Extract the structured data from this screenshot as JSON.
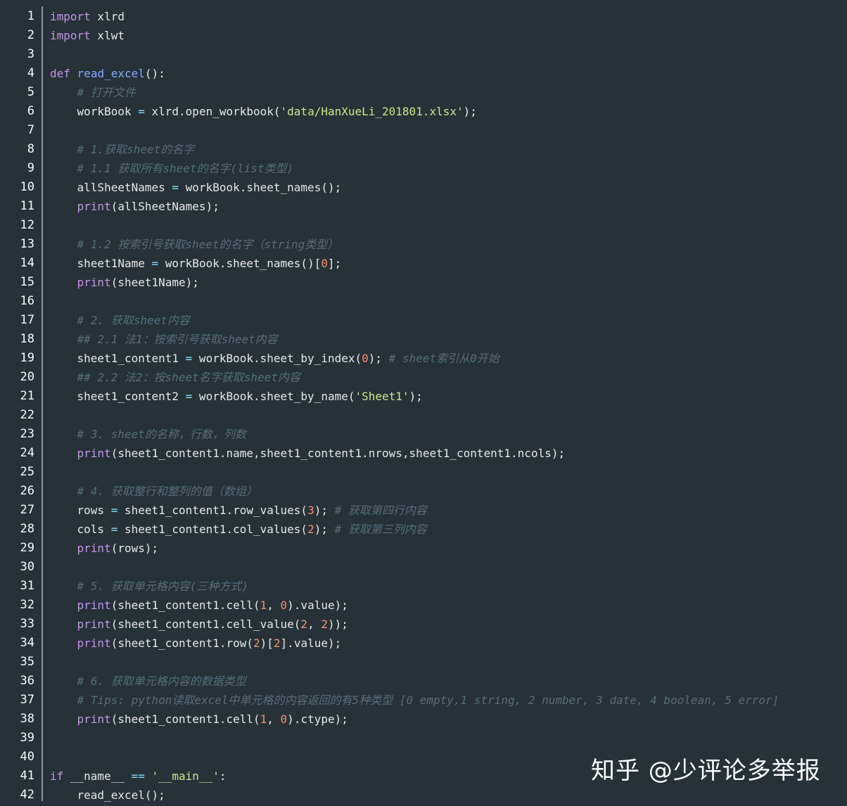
{
  "editor": {
    "lines": [
      {
        "n": "1",
        "t": [
          [
            "kw",
            "import"
          ],
          [
            "pl",
            " xlrd"
          ]
        ]
      },
      {
        "n": "2",
        "t": [
          [
            "kw",
            "import"
          ],
          [
            "pl",
            " xlwt"
          ]
        ]
      },
      {
        "n": "3",
        "t": []
      },
      {
        "n": "4",
        "t": [
          [
            "kw",
            "def"
          ],
          [
            "pl",
            " "
          ],
          [
            "fn",
            "read_excel"
          ],
          [
            "pl",
            "():"
          ]
        ]
      },
      {
        "n": "5",
        "t": [
          [
            "pl",
            "    "
          ],
          [
            "cm",
            "# 打开文件"
          ]
        ]
      },
      {
        "n": "6",
        "t": [
          [
            "pl",
            "    workBook "
          ],
          [
            "op",
            "="
          ],
          [
            "pl",
            " xlrd.open_workbook("
          ],
          [
            "str",
            "'data/HanXueLi_201801.xlsx'"
          ],
          [
            "pl",
            ");"
          ]
        ]
      },
      {
        "n": "7",
        "t": []
      },
      {
        "n": "8",
        "t": [
          [
            "pl",
            "    "
          ],
          [
            "cm",
            "# 1.获取sheet的名字"
          ]
        ]
      },
      {
        "n": "9",
        "t": [
          [
            "pl",
            "    "
          ],
          [
            "cm",
            "# 1.1 获取所有sheet的名字(list类型)"
          ]
        ]
      },
      {
        "n": "10",
        "t": [
          [
            "pl",
            "    allSheetNames "
          ],
          [
            "op",
            "="
          ],
          [
            "pl",
            " workBook.sheet_names();"
          ]
        ]
      },
      {
        "n": "11",
        "t": [
          [
            "pl",
            "    "
          ],
          [
            "pr",
            "print"
          ],
          [
            "pl",
            "(allSheetNames);"
          ]
        ]
      },
      {
        "n": "12",
        "t": []
      },
      {
        "n": "13",
        "t": [
          [
            "pl",
            "    "
          ],
          [
            "cm",
            "# 1.2 按索引号获取sheet的名字（string类型）"
          ]
        ]
      },
      {
        "n": "14",
        "t": [
          [
            "pl",
            "    sheet1Name "
          ],
          [
            "op",
            "="
          ],
          [
            "pl",
            " workBook.sheet_names()["
          ],
          [
            "num",
            "0"
          ],
          [
            "pl",
            "];"
          ]
        ]
      },
      {
        "n": "15",
        "t": [
          [
            "pl",
            "    "
          ],
          [
            "pr",
            "print"
          ],
          [
            "pl",
            "(sheet1Name);"
          ]
        ]
      },
      {
        "n": "16",
        "t": []
      },
      {
        "n": "17",
        "t": [
          [
            "pl",
            "    "
          ],
          [
            "cm",
            "# 2. 获取sheet内容"
          ]
        ]
      },
      {
        "n": "18",
        "t": [
          [
            "pl",
            "    "
          ],
          [
            "cm",
            "## 2.1 法1：按索引号获取sheet内容"
          ]
        ]
      },
      {
        "n": "19",
        "t": [
          [
            "pl",
            "    sheet1_content1 "
          ],
          [
            "op",
            "="
          ],
          [
            "pl",
            " workBook.sheet_by_index("
          ],
          [
            "num",
            "0"
          ],
          [
            "pl",
            "); "
          ],
          [
            "cm",
            "# sheet索引从0开始"
          ]
        ]
      },
      {
        "n": "20",
        "t": [
          [
            "pl",
            "    "
          ],
          [
            "cm",
            "## 2.2 法2：按sheet名字获取sheet内容"
          ]
        ]
      },
      {
        "n": "21",
        "t": [
          [
            "pl",
            "    sheet1_content2 "
          ],
          [
            "op",
            "="
          ],
          [
            "pl",
            " workBook.sheet_by_name("
          ],
          [
            "str",
            "'Sheet1'"
          ],
          [
            "pl",
            ");"
          ]
        ]
      },
      {
        "n": "22",
        "t": []
      },
      {
        "n": "23",
        "t": [
          [
            "pl",
            "    "
          ],
          [
            "cm",
            "# 3. sheet的名称，行数，列数"
          ]
        ]
      },
      {
        "n": "24",
        "t": [
          [
            "pl",
            "    "
          ],
          [
            "pr",
            "print"
          ],
          [
            "pl",
            "(sheet1_content1.name,sheet1_content1.nrows,sheet1_content1.ncols);"
          ]
        ]
      },
      {
        "n": "25",
        "t": []
      },
      {
        "n": "26",
        "t": [
          [
            "pl",
            "    "
          ],
          [
            "cm",
            "# 4. 获取整行和整列的值（数组）"
          ]
        ]
      },
      {
        "n": "27",
        "t": [
          [
            "pl",
            "    rows "
          ],
          [
            "op",
            "="
          ],
          [
            "pl",
            " sheet1_content1.row_values("
          ],
          [
            "num",
            "3"
          ],
          [
            "pl",
            "); "
          ],
          [
            "cm",
            "# 获取第四行内容"
          ]
        ]
      },
      {
        "n": "28",
        "t": [
          [
            "pl",
            "    cols "
          ],
          [
            "op",
            "="
          ],
          [
            "pl",
            " sheet1_content1.col_values("
          ],
          [
            "num",
            "2"
          ],
          [
            "pl",
            "); "
          ],
          [
            "cm",
            "# 获取第三列内容"
          ]
        ]
      },
      {
        "n": "29",
        "t": [
          [
            "pl",
            "    "
          ],
          [
            "pr",
            "print"
          ],
          [
            "pl",
            "(rows);"
          ]
        ]
      },
      {
        "n": "30",
        "t": []
      },
      {
        "n": "31",
        "t": [
          [
            "pl",
            "    "
          ],
          [
            "cm",
            "# 5. 获取单元格内容(三种方式)"
          ]
        ]
      },
      {
        "n": "32",
        "t": [
          [
            "pl",
            "    "
          ],
          [
            "pr",
            "print"
          ],
          [
            "pl",
            "(sheet1_content1.cell("
          ],
          [
            "num",
            "1"
          ],
          [
            "pl",
            ", "
          ],
          [
            "num",
            "0"
          ],
          [
            "pl",
            ").value);"
          ]
        ]
      },
      {
        "n": "33",
        "t": [
          [
            "pl",
            "    "
          ],
          [
            "pr",
            "print"
          ],
          [
            "pl",
            "(sheet1_content1.cell_value("
          ],
          [
            "num",
            "2"
          ],
          [
            "pl",
            ", "
          ],
          [
            "num",
            "2"
          ],
          [
            "pl",
            "));"
          ]
        ]
      },
      {
        "n": "34",
        "t": [
          [
            "pl",
            "    "
          ],
          [
            "pr",
            "print"
          ],
          [
            "pl",
            "(sheet1_content1.row("
          ],
          [
            "num",
            "2"
          ],
          [
            "pl",
            ")["
          ],
          [
            "num",
            "2"
          ],
          [
            "pl",
            "].value);"
          ]
        ]
      },
      {
        "n": "35",
        "t": []
      },
      {
        "n": "36",
        "t": [
          [
            "pl",
            "    "
          ],
          [
            "cm",
            "# 6. 获取单元格内容的数据类型"
          ]
        ]
      },
      {
        "n": "37",
        "t": [
          [
            "pl",
            "    "
          ],
          [
            "cm",
            "# Tips: python读取excel中单元格的内容返回的有5种类型 [0 empty,1 string, 2 number, 3 date, 4 boolean, 5 error]"
          ]
        ]
      },
      {
        "n": "38",
        "t": [
          [
            "pl",
            "    "
          ],
          [
            "pr",
            "print"
          ],
          [
            "pl",
            "(sheet1_content1.cell("
          ],
          [
            "num",
            "1"
          ],
          [
            "pl",
            ", "
          ],
          [
            "num",
            "0"
          ],
          [
            "pl",
            ").ctype);"
          ]
        ]
      },
      {
        "n": "39",
        "t": []
      },
      {
        "n": "40",
        "t": []
      },
      {
        "n": "41",
        "t": [
          [
            "kw",
            "if"
          ],
          [
            "pl",
            " __name__ "
          ],
          [
            "op",
            "=="
          ],
          [
            "pl",
            " "
          ],
          [
            "str",
            "'__main__'"
          ],
          [
            "pl",
            ":"
          ]
        ]
      },
      {
        "n": "42",
        "t": [
          [
            "pl",
            "    read_excel();"
          ]
        ]
      }
    ]
  },
  "watermark": "知乎 @少评论多举报",
  "colors": {
    "background": "#263238",
    "keyword": "#c792ea",
    "function": "#82aaff",
    "operator": "#89ddff",
    "string": "#c3e88d",
    "number": "#f78c6c",
    "comment": "#546e7a"
  }
}
